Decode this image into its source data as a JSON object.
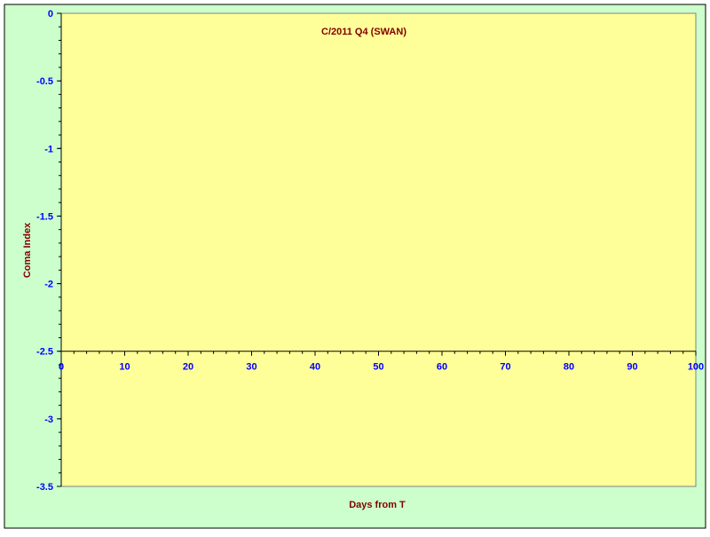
{
  "colors": {
    "chart_background": "#ccffcc",
    "plot_background": "#ffff99",
    "axis_line": "#000000",
    "tick_label": "#0000ff",
    "title_text": "#800000"
  },
  "chart_data": {
    "type": "scatter",
    "title": "C/2011 Q4 (SWAN)",
    "xlabel": "Days from T",
    "ylabel": "Coma Index",
    "xlim": [
      0,
      100
    ],
    "ylim": [
      -3.5,
      0
    ],
    "x_ticks": [
      0,
      10,
      20,
      30,
      40,
      50,
      60,
      70,
      80,
      90,
      100
    ],
    "y_ticks": [
      0,
      -0.5,
      -1,
      -1.5,
      -2,
      -2.5,
      -3,
      -3.5
    ],
    "x_tick_labels": [
      "0",
      "10",
      "20",
      "30",
      "40",
      "50",
      "60",
      "70",
      "80",
      "90",
      "100"
    ],
    "y_tick_labels": [
      "0",
      "-0.5",
      "-1",
      "-1.5",
      "-2",
      "-2.5",
      "-3",
      "-3.5"
    ],
    "x_axis_crosses_at": -2.5,
    "grid": false,
    "legend": "none",
    "series": [
      {
        "x": [],
        "y": []
      }
    ]
  }
}
